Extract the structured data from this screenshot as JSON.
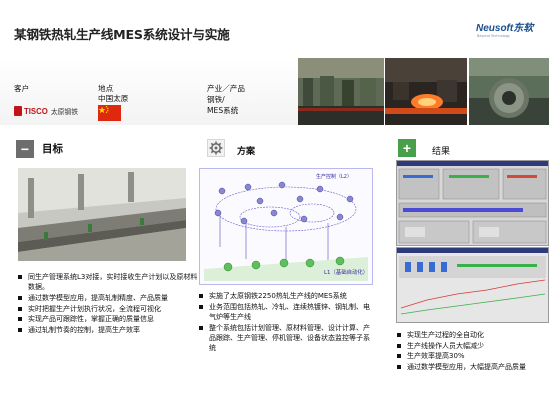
{
  "title": "某钢铁热轧生产线MES系统设计与实施",
  "brand": {
    "name": "Neusoft东软",
    "tagline": "Beyond Technology"
  },
  "info": {
    "client_label": "客户",
    "location_label": "地点",
    "location_value": "中国太原",
    "industry_label": "产业／产品",
    "industry_value": "钢铁/",
    "product_value": "MES系统",
    "client_logo_text": "TISCO",
    "client_name": "太原钢铁"
  },
  "sections": {
    "goal": {
      "icon": "minus-icon",
      "title": "目标",
      "bullets": [
        "同生产管理系统L3对接，实时接收生产计划以及原材料数据。",
        "通过数学模型应用，提高轧制精度、产品质量",
        "实时把握生产计划执行状况，全流程可视化",
        "实现产品可跟踪性，掌握正确的质量信息",
        "通过轧制节奏的控制，提高生产效率"
      ]
    },
    "plan": {
      "icon": "gear-icon",
      "title": "方案",
      "diagram_labels": {
        "top": "生产控制（L2）",
        "bottom": "L1（基础自动化）"
      },
      "bullets": [
        "实施了太原钢铁2250热轧生产线的MES系统",
        "业务范围包括热轧、冷轧、连续热镀锌、钢轧制、电气炉等生产线",
        "整个系统包括计划管理、原材料管理、设计计算、产品跟踪、生产管理、停机管理、设备状态监控等子系统"
      ]
    },
    "result": {
      "icon": "plus-icon",
      "title": "结果",
      "bullets": [
        "实现生产过程的全自动化",
        "生产线操作人员大幅减少",
        "生产效率提高30%",
        "通过数学模型应用，大幅提高产品质量"
      ]
    }
  },
  "colors": {
    "tisco_red": "#c0161a",
    "result_green": "#4aa04a",
    "goal_gray": "#6d6d6d",
    "brand_blue": "#1a4f8f"
  }
}
